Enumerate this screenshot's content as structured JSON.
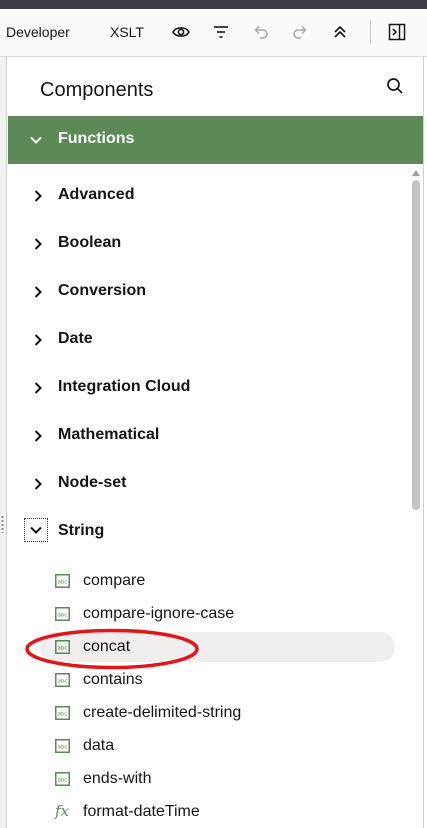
{
  "toolbar": {
    "developer_label": "Developer",
    "xslt_label": "XSLT",
    "icons": [
      "eye-icon",
      "filter-icon",
      "undo-icon",
      "redo-icon",
      "collapse-all-icon",
      "panel-toggle-icon"
    ]
  },
  "panel": {
    "title": "Components",
    "search_icon": "search-icon"
  },
  "functions": {
    "label": "Functions",
    "expanded": true,
    "accent": "#5b8a57",
    "categories": [
      {
        "label": "Advanced",
        "expanded": false
      },
      {
        "label": "Boolean",
        "expanded": false
      },
      {
        "label": "Conversion",
        "expanded": false
      },
      {
        "label": "Date",
        "expanded": false
      },
      {
        "label": "Integration Cloud",
        "expanded": false
      },
      {
        "label": "Mathematical",
        "expanded": false
      },
      {
        "label": "Node-set",
        "expanded": false
      },
      {
        "label": "String",
        "expanded": true
      }
    ],
    "string_functions": [
      {
        "label": "compare",
        "icon": "abc-icon"
      },
      {
        "label": "compare-ignore-case",
        "icon": "abc-icon"
      },
      {
        "label": "concat",
        "icon": "abc-icon",
        "highlighted": true
      },
      {
        "label": "contains",
        "icon": "abc-icon"
      },
      {
        "label": "create-delimited-string",
        "icon": "abc-icon"
      },
      {
        "label": "data",
        "icon": "abc-icon"
      },
      {
        "label": "ends-with",
        "icon": "abc-icon"
      },
      {
        "label": "format-dateTime",
        "icon": "fx-icon"
      }
    ]
  },
  "annotation_color": "#e0161b"
}
